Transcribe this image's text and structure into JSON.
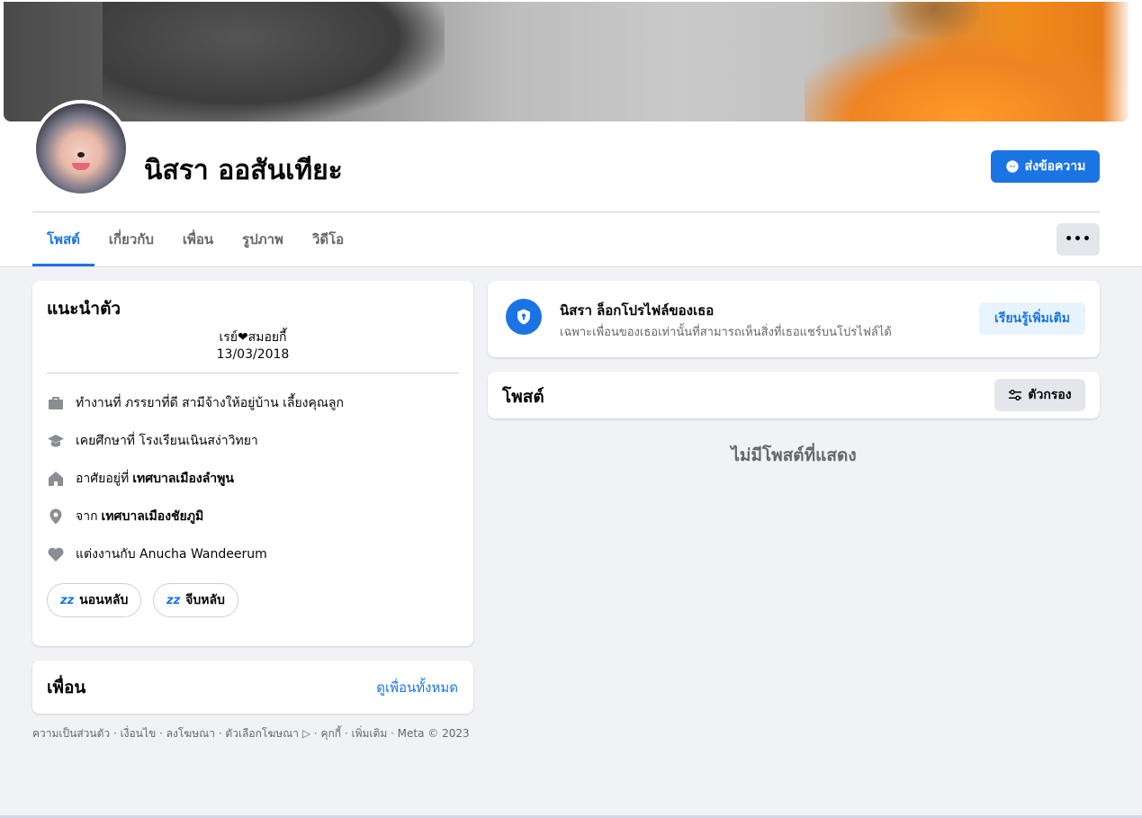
{
  "profile": {
    "name": "นิสรา ออสันเทียะ",
    "message_button": "ส่งข้อความ"
  },
  "tabs": [
    {
      "label": "โพสต์",
      "active": true
    },
    {
      "label": "เกี่ยวกับ",
      "active": false
    },
    {
      "label": "เพื่อน",
      "active": false
    },
    {
      "label": "รูปภาพ",
      "active": false
    },
    {
      "label": "วิดีโอ",
      "active": false
    }
  ],
  "more_button": "•••",
  "intro": {
    "title": "แนะนำตัว",
    "bio_line1": "เรย์❤สมอยกี้",
    "bio_line2": "13/03/2018",
    "details": [
      {
        "icon": "briefcase-icon",
        "prefix": "ทำงานที่ ภรรยาที่ดี สามีจ้างให้อยู่บ้าน เลี้ยงคุณลูก",
        "value": ""
      },
      {
        "icon": "graduation-cap-icon",
        "prefix": "เคยศึกษาที่ โรงเรียนเนินสง่าวิทยา",
        "value": ""
      },
      {
        "icon": "home-icon",
        "prefix": "อาศัยอยู่ที่",
        "value": "เทศบาลเมืองลำพูน"
      },
      {
        "icon": "location-pin-icon",
        "prefix": "จาก",
        "value": "เทศบาลเมืองชัยภูมิ"
      },
      {
        "icon": "heart-icon",
        "prefix": "แต่งงานกับ Anucha Wandeerum",
        "value": ""
      }
    ],
    "chips": [
      {
        "emoji": "💤",
        "label": "นอนหลับ"
      },
      {
        "emoji": "💤",
        "label": "จีบหลับ"
      }
    ]
  },
  "friends": {
    "title": "เพื่อน",
    "see_all": "ดูเพื่อนทั้งหมด"
  },
  "footer": "ความเป็นส่วนตัว · เงื่อนไข · ลงโฆษณา · ตัวเลือกโฆษณา ▷ · คุกกี้ · เพิ่มเติม · Meta © 2023",
  "locked": {
    "title": "นิสรา ล็อกโปรไฟล์ของเธอ",
    "description": "เฉพาะเพื่อนของเธอเท่านั้นที่สามารถเห็นสิ่งที่เธอแชร์บนโปรไฟล์ได้",
    "learn_more": "เรียนรู้เพิ่มเติม"
  },
  "posts": {
    "title": "โพสต์",
    "filter_button": "ตัวกรอง",
    "empty_text": "ไม่มีโพสต์ที่แสดง"
  },
  "colors": {
    "accent": "#1b74e4",
    "background": "#f0f2f5"
  }
}
